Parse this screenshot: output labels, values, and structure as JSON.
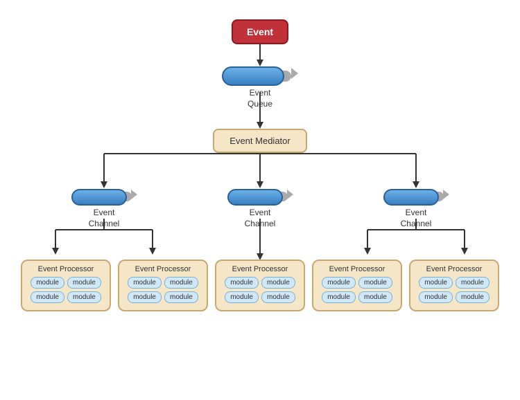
{
  "event": {
    "label": "Event"
  },
  "queue": {
    "label": "Event\nQueue"
  },
  "mediator": {
    "label": "Event Mediator"
  },
  "channels": [
    {
      "label": "Event\nChannel"
    },
    {
      "label": "Event\nChannel"
    },
    {
      "label": "Event\nChannel"
    }
  ],
  "processors": [
    {
      "title": "Event Processor",
      "modules": [
        [
          "module",
          "module"
        ],
        [
          "module",
          "module"
        ]
      ]
    },
    {
      "title": "Event Processor",
      "modules": [
        [
          "module",
          "module"
        ],
        [
          "module",
          "module"
        ]
      ]
    },
    {
      "title": "Event Processor",
      "modules": [
        [
          "module",
          "module"
        ],
        [
          "module",
          "module"
        ]
      ]
    },
    {
      "title": "Event Processor",
      "modules": [
        [
          "module",
          "module"
        ],
        [
          "module",
          "module"
        ]
      ]
    },
    {
      "title": "Event Processor",
      "modules": [
        [
          "module",
          "module"
        ],
        [
          "module",
          "module"
        ]
      ]
    }
  ],
  "colors": {
    "event_bg": "#c0313a",
    "event_border": "#8b1a22",
    "queue_bg": "#3a7fc1",
    "mediator_bg": "#f5e6c8",
    "mediator_border": "#c8a870",
    "processor_bg": "#f5e6c8",
    "module_bg": "#d0e8f8",
    "module_border": "#7ab0d8"
  }
}
